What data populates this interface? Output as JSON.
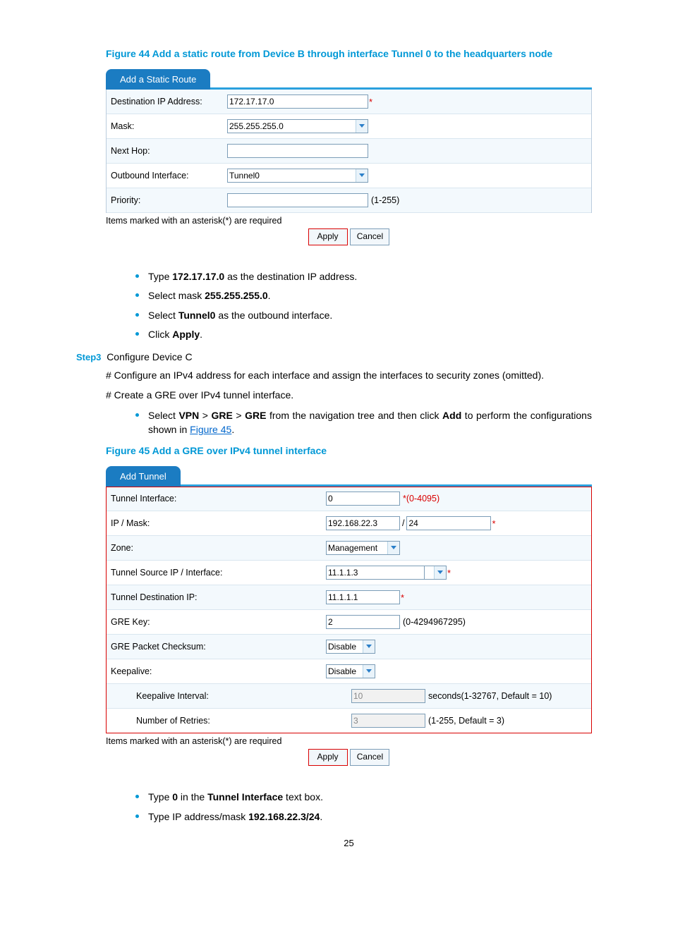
{
  "figure44": {
    "title": "Figure 44 Add a static route from Device B through interface Tunnel 0 to the headquarters node",
    "tab": "Add a Static Route",
    "rows": {
      "dest_label": "Destination IP Address:",
      "dest_value": "172.17.17.0",
      "mask_label": "Mask:",
      "mask_value": "255.255.255.0",
      "nexthop_label": "Next Hop:",
      "nexthop_value": "",
      "outif_label": "Outbound Interface:",
      "outif_value": "Tunnel0",
      "prio_label": "Priority:",
      "prio_value": "",
      "prio_hint": "(1-255)"
    },
    "note": "Items marked with an asterisk(*) are required",
    "apply": "Apply",
    "cancel": "Cancel"
  },
  "bullets1": {
    "b1_a": "Type ",
    "b1_b": "172.17.17.0",
    "b1_c": " as the destination IP address.",
    "b2_a": "Select mask ",
    "b2_b": "255.255.255.0",
    "b2_c": ".",
    "b3_a": "Select ",
    "b3_b": "Tunnel0",
    "b3_c": " as the outbound interface.",
    "b4_a": "Click ",
    "b4_b": "Apply",
    "b4_c": "."
  },
  "step3": {
    "label": "Step3",
    "title": "Configure Device C",
    "p1": "# Configure an IPv4 address for each interface and assign the interfaces to security zones (omitted).",
    "p2": "# Create a GRE over IPv4 tunnel interface.",
    "nav_a": "Select ",
    "nav_b": "VPN",
    "nav_c": " > ",
    "nav_d": "GRE",
    "nav_e": " > ",
    "nav_f": "GRE",
    "nav_g": " from the navigation tree and then click ",
    "nav_h": "Add",
    "nav_i": " to perform the configurations shown in ",
    "nav_link": "Figure 45",
    "nav_j": "."
  },
  "figure45": {
    "title": "Figure 45 Add a GRE over IPv4 tunnel interface",
    "tab": "Add Tunnel",
    "rows": {
      "ti_label": "Tunnel Interface:",
      "ti_value": "0",
      "ti_hint": "*(0-4095)",
      "ipmask_label": "IP / Mask:",
      "ip_value": "192.168.22.3",
      "mask_value": "24",
      "zone_label": "Zone:",
      "zone_value": "Management",
      "src_label": "Tunnel Source IP / Interface:",
      "src_value": "11.1.1.3",
      "dst_label": "Tunnel Destination IP:",
      "dst_value": "11.1.1.1",
      "key_label": "GRE Key:",
      "key_value": "2",
      "key_hint": "(0-4294967295)",
      "cksum_label": "GRE Packet Checksum:",
      "cksum_value": "Disable",
      "keep_label": "Keepalive:",
      "keep_value": "Disable",
      "kint_label": "Keepalive Interval:",
      "kint_value": "10",
      "kint_hint": "seconds(1-32767, Default = 10)",
      "kret_label": "Number of Retries:",
      "kret_value": "3",
      "kret_hint": "(1-255, Default = 3)"
    },
    "note": "Items marked with an asterisk(*) are required",
    "apply": "Apply",
    "cancel": "Cancel"
  },
  "bullets2": {
    "b1_a": "Type ",
    "b1_b": "0",
    "b1_c": " in the ",
    "b1_d": "Tunnel Interface",
    "b1_e": " text box.",
    "b2_a": "Type IP address/mask ",
    "b2_b": "192.168.22.3/24",
    "b2_c": "."
  },
  "pagenum": "25"
}
